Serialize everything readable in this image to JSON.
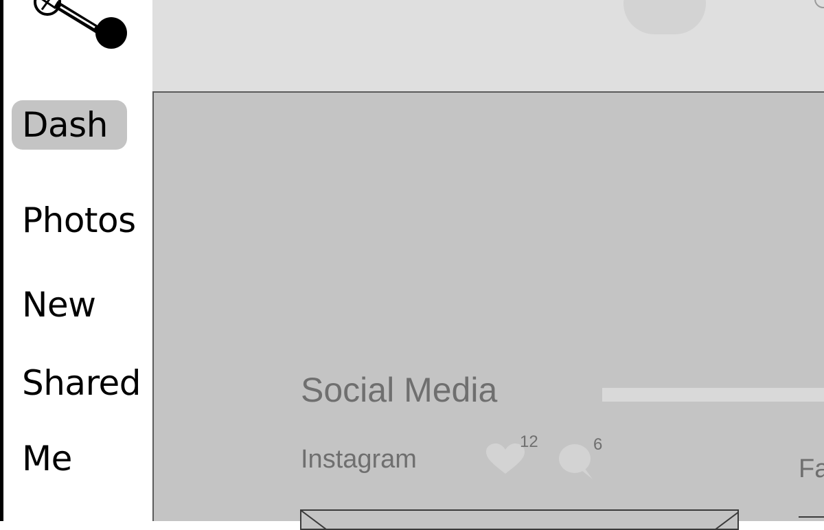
{
  "sidebar": {
    "items": [
      {
        "label": "Dash",
        "active": true
      },
      {
        "label": "Photos",
        "active": false
      },
      {
        "label": "New",
        "active": false
      },
      {
        "label": "Shared",
        "active": false
      },
      {
        "label": "Me",
        "active": false
      }
    ]
  },
  "logo": {
    "icon": "pinwheel-dial-logo-icon"
  },
  "main": {
    "section_title": "Social Media",
    "instagram": {
      "label": "Instagram",
      "likes": "12",
      "comments": "6",
      "like_icon": "heart-icon",
      "comment_icon": "comment-bubble-icon"
    },
    "facebook": {
      "label": "Fa"
    }
  },
  "colors": {
    "sidebar_active": "#c4c4c4",
    "header_bg": "#dfdfdf",
    "main_bg": "#c4c4c4",
    "muted_text": "#6f6f6f"
  }
}
